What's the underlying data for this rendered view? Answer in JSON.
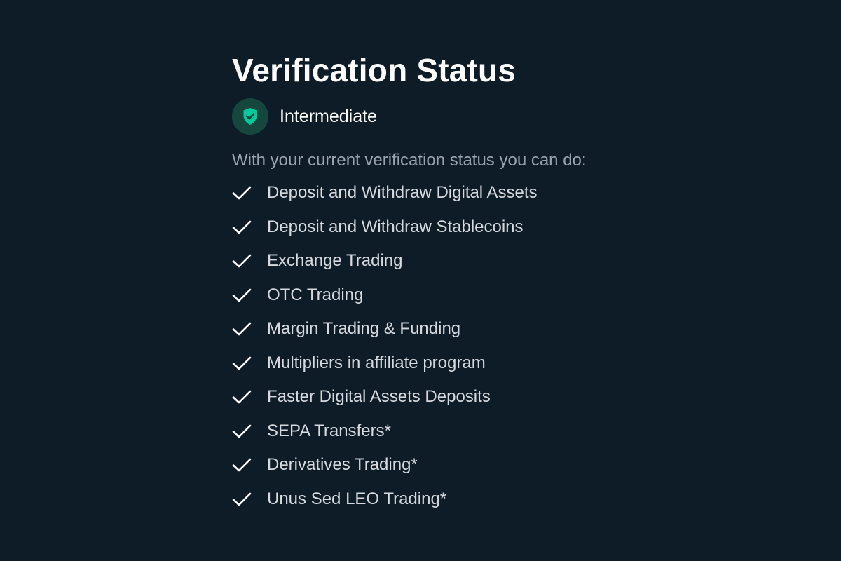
{
  "title": "Verification Status",
  "level": {
    "label": "Intermediate",
    "icon": "shield-check-icon",
    "badge_color": "#15473f",
    "icon_color": "#03ca9b"
  },
  "intro": "With your current verification status you can do:",
  "features": [
    {
      "label": "Deposit and Withdraw Digital Assets",
      "icon": "check-icon"
    },
    {
      "label": "Deposit and Withdraw Stablecoins",
      "icon": "check-icon"
    },
    {
      "label": "Exchange Trading",
      "icon": "check-icon"
    },
    {
      "label": "OTC Trading",
      "icon": "check-icon"
    },
    {
      "label": "Margin Trading & Funding",
      "icon": "check-icon"
    },
    {
      "label": "Multipliers in affiliate program",
      "icon": "check-icon"
    },
    {
      "label": "Faster Digital Assets Deposits",
      "icon": "check-icon"
    },
    {
      "label": "SEPA Transfers*",
      "icon": "check-icon"
    },
    {
      "label": "Derivatives Trading*",
      "icon": "check-icon"
    },
    {
      "label": "Unus Sed LEO Trading*",
      "icon": "check-icon"
    }
  ],
  "colors": {
    "background": "#0e1c28",
    "title": "#ffffff",
    "muted_text": "#9aa4ad",
    "feature_text": "#d6dade"
  }
}
